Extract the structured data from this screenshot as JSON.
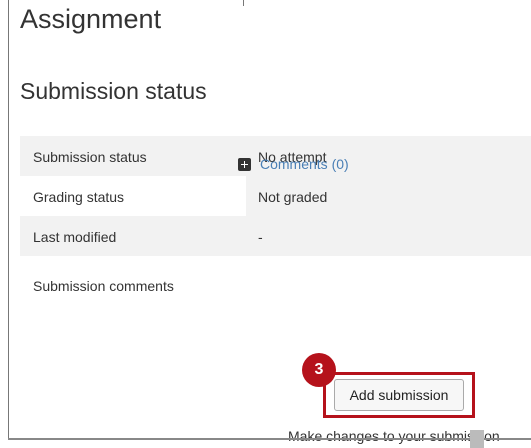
{
  "page": {
    "title": "Assignment",
    "section_title": "Submission status"
  },
  "status_table": {
    "rows": [
      {
        "label": "Submission status",
        "value": "No attempt"
      },
      {
        "label": "Grading status",
        "value": "Not graded"
      },
      {
        "label": "Last modified",
        "value": "-"
      },
      {
        "label": "Submission comments",
        "value": ""
      }
    ],
    "comments_link": "Comments (0)"
  },
  "actions": {
    "add_submission_label": "Add submission",
    "step_number": "3",
    "helper_text": "Make changes to your submission"
  },
  "colors": {
    "highlight": "#b5121b",
    "link": "#4a7fb5"
  },
  "icons": {
    "comments_expand": "plus-square-icon"
  }
}
